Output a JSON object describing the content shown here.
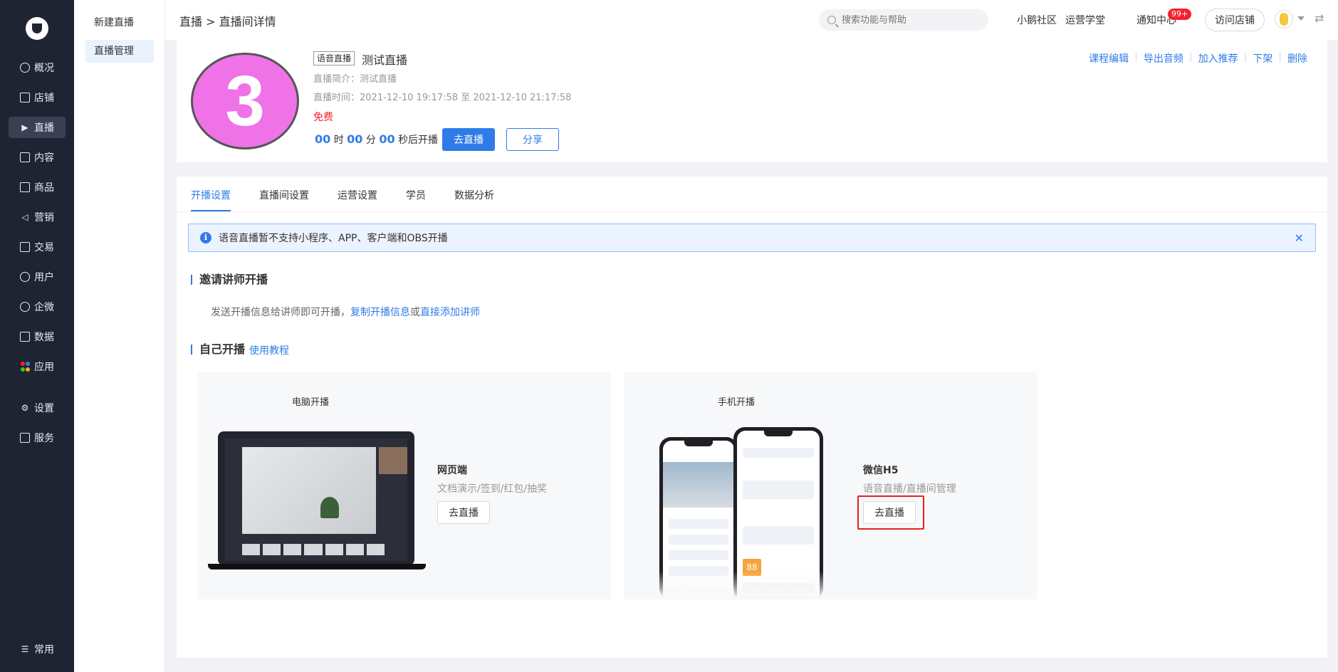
{
  "sidebar": {
    "items": [
      {
        "label": "概况",
        "icon": "pie-chart-icon"
      },
      {
        "label": "店铺",
        "icon": "store-icon"
      },
      {
        "label": "直播",
        "icon": "live-video-icon"
      },
      {
        "label": "内容",
        "icon": "document-icon"
      },
      {
        "label": "商品",
        "icon": "bag-icon"
      },
      {
        "label": "营销",
        "icon": "megaphone-icon"
      },
      {
        "label": "交易",
        "icon": "trade-icon"
      },
      {
        "label": "用户",
        "icon": "user-icon"
      },
      {
        "label": "企微",
        "icon": "wecom-icon"
      },
      {
        "label": "数据",
        "icon": "data-icon"
      },
      {
        "label": "应用",
        "icon": "apps-icon"
      },
      {
        "label": "设置",
        "icon": "gear-icon"
      },
      {
        "label": "服务",
        "icon": "service-icon"
      }
    ],
    "common": {
      "label": "常用",
      "icon": "list-icon"
    },
    "active": "直播"
  },
  "subnav": {
    "items": [
      "新建直播",
      "直播管理"
    ],
    "active": "直播管理"
  },
  "header": {
    "breadcrumb": "直播 > 直播间详情",
    "search_placeholder": "搜索功能与帮助",
    "links": [
      "小鹅社区",
      "运营学堂",
      "通知中心"
    ],
    "badge": "99+",
    "visit_store": "访问店铺"
  },
  "live": {
    "cover_text": "3",
    "cover_color": "#ef73e6",
    "tag": "语音直播",
    "title": "测试直播",
    "intro": "直播简介：测试直播",
    "time": "直播时间：2021-12-10 19:17:58 至 2021-12-10 21:17:58",
    "price": "免费",
    "countdown": {
      "h": "00",
      "h_unit": "时",
      "m": "00",
      "m_unit": "分",
      "s": "00",
      "s_unit": "秒后开播"
    },
    "go_live": "去直播",
    "share": "分享",
    "actions": [
      "课程编辑",
      "导出音频",
      "加入推荐",
      "下架",
      "删除"
    ]
  },
  "tabs": [
    "开播设置",
    "直播间设置",
    "运营设置",
    "学员",
    "数据分析"
  ],
  "active_tab": "开播设置",
  "alert": "语音直播暂不支持小程序、APP、客户端和OBS开播",
  "invite": {
    "title": "邀请讲师开播",
    "desc_prefix": "发送开播信息给讲师即可开播，",
    "copy_link": "复制开播信息",
    "or": "或",
    "add_link": "直接添加讲师"
  },
  "self": {
    "title": "自己开播",
    "tutorial": "使用教程",
    "pc": {
      "title": "电脑开播",
      "name": "网页端",
      "desc": "文档演示/签到/红包/抽奖",
      "button": "去直播"
    },
    "mobile": {
      "title": "手机开播",
      "name": "微信H5",
      "desc": "语音直播/直播间管理",
      "button": "去直播",
      "price_tag": "88"
    }
  },
  "colors": {
    "primary": "#2f7ce8",
    "danger": "#f5222d",
    "sidebar_bg": "#1f2433"
  }
}
